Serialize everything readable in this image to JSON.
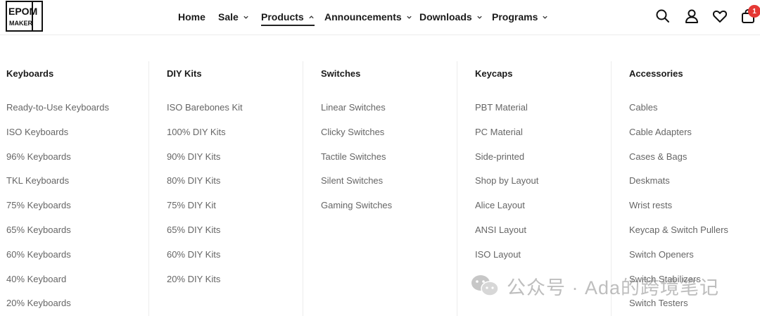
{
  "brand": {
    "logo_lines": [
      "EPOM",
      "MAKER"
    ]
  },
  "nav": {
    "items": [
      {
        "label": "Home",
        "has_dropdown": false
      },
      {
        "label": "Sale",
        "has_dropdown": true
      },
      {
        "label": "Products",
        "has_dropdown": true,
        "active": true
      },
      {
        "label": "Announcements",
        "has_dropdown": true
      },
      {
        "label": "Downloads",
        "has_dropdown": true
      },
      {
        "label": "Programs",
        "has_dropdown": true
      }
    ]
  },
  "header_icons": [
    "search-icon",
    "user-icon",
    "heart-icon",
    "cart-icon"
  ],
  "cart": {
    "count": "1"
  },
  "colors": {
    "badge": "#e53935",
    "text": "#1a1a1a",
    "muted": "#666666",
    "divider": "#ececec"
  },
  "menu": {
    "columns": [
      {
        "title": "Keyboards",
        "items": [
          "Ready-to-Use Keyboards",
          "ISO Keyboards",
          "96% Keyboards",
          "TKL Keyboards",
          "75% Keyboards",
          "65% Keyboards",
          "60% Keyboards",
          "40% Keyboard",
          "20% Keyboards"
        ]
      },
      {
        "title": "DIY Kits",
        "items": [
          "ISO Barebones Kit",
          "100% DIY Kits",
          "90% DIY Kits",
          "80% DIY Kits",
          "75% DIY Kit",
          "65% DIY Kits",
          "60% DIY Kits",
          "20% DIY Kits"
        ]
      },
      {
        "title": "Switches",
        "items": [
          "Linear Switches",
          "Clicky Switches",
          "Tactile Switches",
          "Silent Switches",
          "Gaming Switches"
        ]
      },
      {
        "title": "Keycaps",
        "items": [
          "PBT Material",
          "PC Material",
          "Side-printed",
          "Shop by Layout",
          "Alice Layout",
          "ANSI Layout",
          "ISO Layout"
        ]
      },
      {
        "title": "Accessories",
        "items": [
          "Cables",
          "Cable Adapters",
          "Cases & Bags",
          "Deskmats",
          "Wrist rests",
          "Keycap & Switch Pullers",
          "Switch Openers",
          "Switch Stabilizers",
          "Switch Testers"
        ]
      }
    ]
  },
  "watermark": {
    "text": "公众号 · Ada的跨境笔记"
  }
}
